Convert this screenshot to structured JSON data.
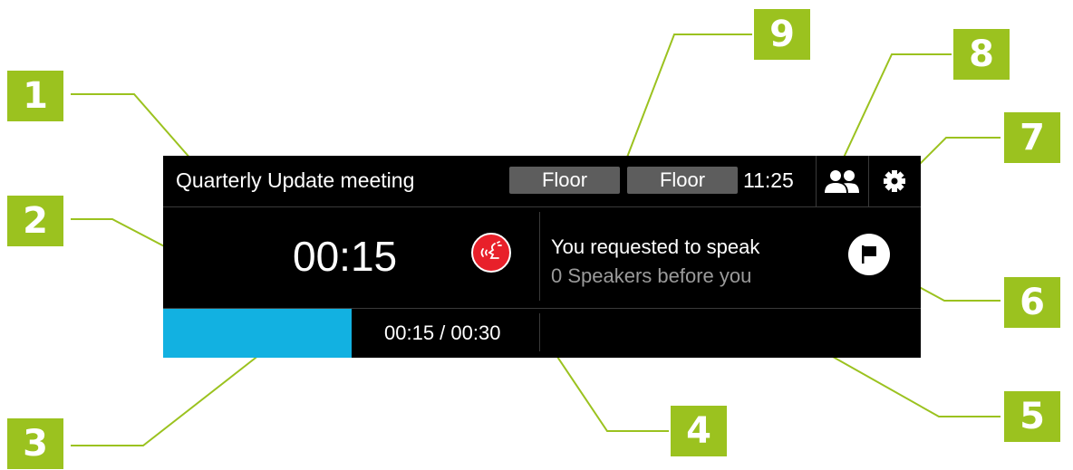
{
  "callouts": [
    "1",
    "2",
    "3",
    "4",
    "5",
    "6",
    "7",
    "8",
    "9"
  ],
  "header": {
    "meeting_title": "Quarterly Update meeting",
    "floor_button_1": "Floor",
    "floor_button_2": "Floor",
    "clock": "11:25",
    "participants_icon": "people-icon",
    "settings_icon": "gear-icon"
  },
  "speaking": {
    "timer": "00:15",
    "speak_icon": "speaker-request-icon",
    "progress_text": "00:15 / 00:30",
    "progress_fraction": 0.5
  },
  "request": {
    "title": "You requested to speak",
    "subtitle": "0 Speakers before you",
    "flag_icon": "flag-icon"
  },
  "colors": {
    "callout": "#9bc21f",
    "progress": "#12b1e1",
    "speak_button": "#e8202a",
    "panel": "#000000"
  }
}
